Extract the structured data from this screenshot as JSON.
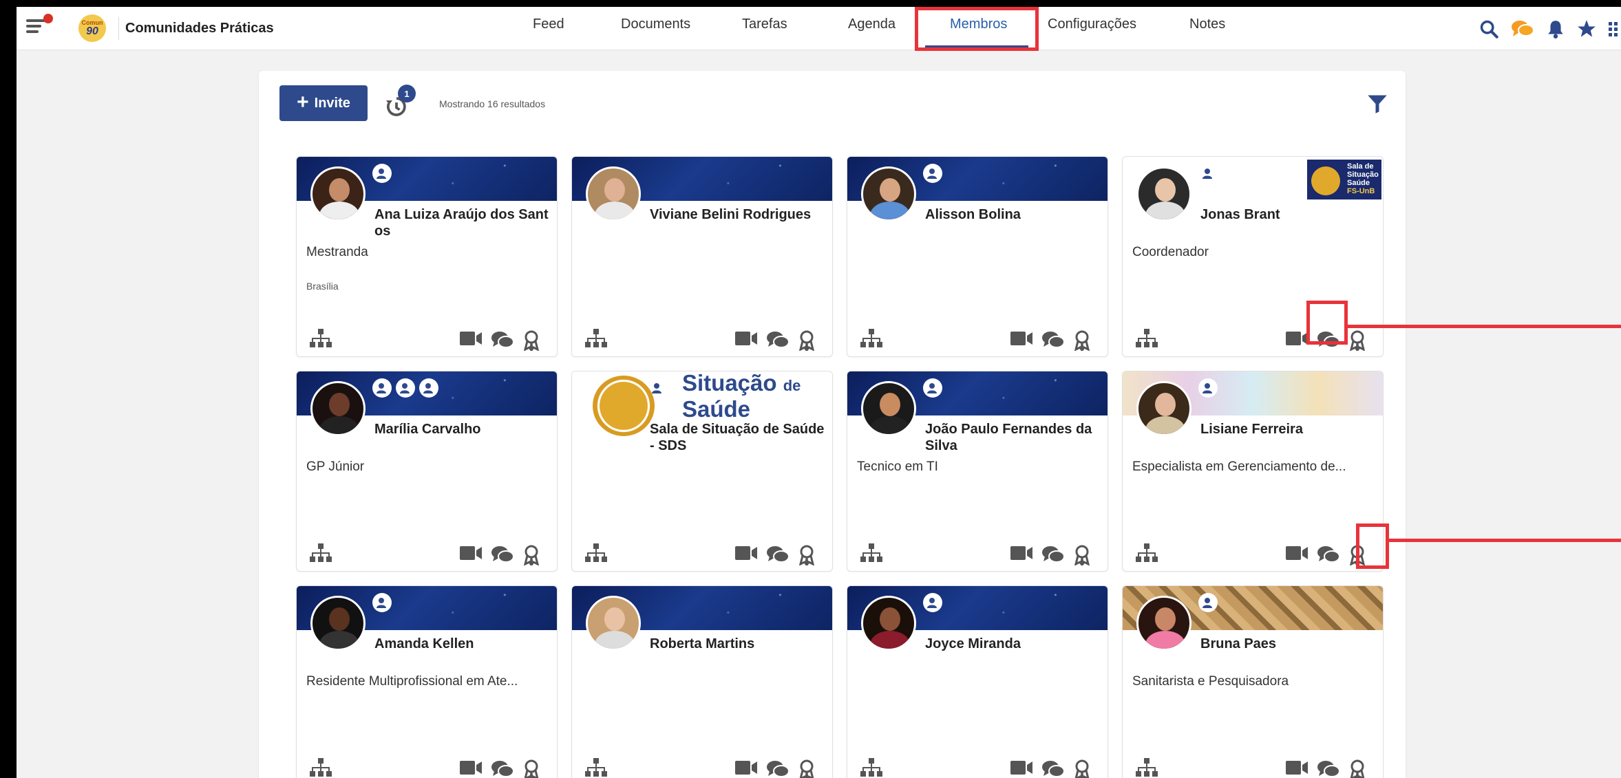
{
  "app": {
    "title": "Comunidades Práticas",
    "logo_top": "Comun",
    "logo_bottom": "90"
  },
  "nav": [
    {
      "label": "Feed"
    },
    {
      "label": "Documents"
    },
    {
      "label": "Tarefas"
    },
    {
      "label": "Agenda"
    },
    {
      "label": "Membros",
      "active": true
    },
    {
      "label": "Configurações"
    },
    {
      "label": "Notes"
    }
  ],
  "toolbar": {
    "invite_label": "Invite",
    "history_badge": "1",
    "results_text": "Mostrando 16 resultados"
  },
  "colors": {
    "primary": "#2e4a8c",
    "highlight": "#e8333a",
    "chat_orange": "#f59b23"
  },
  "members": [
    {
      "name": "Ana Luiza Araújo dos Santos",
      "title": "Mestranda",
      "location": "Brasília",
      "roles": 1,
      "banner": "space"
    },
    {
      "name": "Viviane Belini Rodrigues",
      "title": "",
      "location": "",
      "roles": 0,
      "banner": "space"
    },
    {
      "name": "Alisson Bolina",
      "title": "",
      "location": "",
      "roles": 1,
      "banner": "space"
    },
    {
      "name": "Jonas Brant",
      "title": "Coordenador",
      "location": "",
      "roles": 1,
      "banner": "white",
      "banner_logo": [
        "Sala de",
        "Situação",
        "Saúde",
        "FS-UnB"
      ]
    },
    {
      "name": "Marília Carvalho",
      "title": "GP Júnior",
      "location": "",
      "roles": 3,
      "banner": "space"
    },
    {
      "name": "Sala de Situação de Saúde - SDS",
      "title": "",
      "location": "",
      "roles": 1,
      "banner": "white",
      "sds": [
        "Situação",
        "de",
        "Saúde"
      ]
    },
    {
      "name": "João Paulo Fernandes da Silva",
      "title": "Tecnico em TI",
      "location": "",
      "roles": 1,
      "banner": "space"
    },
    {
      "name": "Lisiane Ferreira",
      "title": "Especialista em Gerenciamento de...",
      "location": "",
      "roles": 1,
      "banner": "gears"
    },
    {
      "name": "Amanda Kellen",
      "title": "Residente Multiprofissional em Ate...",
      "location": "",
      "roles": 1,
      "banner": "space"
    },
    {
      "name": "Roberta Martins",
      "title": "",
      "location": "",
      "roles": 0,
      "banner": "space"
    },
    {
      "name": "Joyce Miranda",
      "title": "",
      "location": "",
      "roles": 1,
      "banner": "space"
    },
    {
      "name": "Bruna Paes",
      "title": "Sanitarista e Pesquisadora",
      "location": "",
      "roles": 1,
      "banner": "giraffe"
    }
  ]
}
